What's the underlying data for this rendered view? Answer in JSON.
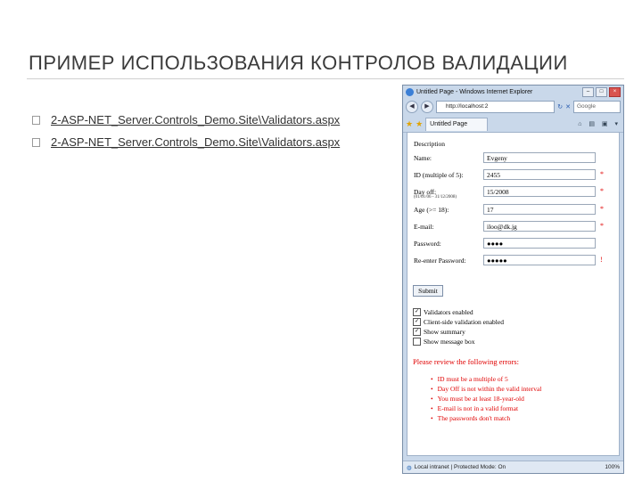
{
  "slide": {
    "title": "ПРИМЕР ИСПОЛЬЗОВАНИЯ КОНТРОЛОВ ВАЛИДАЦИИ",
    "links": [
      "2-ASP-NET_Server.Controls_Demo.Site\\Validators.aspx",
      "2-ASP-NET_Server.Controls_Demo.Site\\Validators.aspx"
    ]
  },
  "browser": {
    "window_title": "Untitled Page - Windows Internet Explorer",
    "address": "http://localhost:2",
    "search_placeholder": "Google",
    "tab_label": "Untitled Page",
    "status_text": "Local intranet | Protected Mode: On",
    "zoom": "100%"
  },
  "form": {
    "heading": "Description",
    "fields": [
      {
        "label": "Name:",
        "note": "",
        "value": "Evgeny",
        "required": ""
      },
      {
        "label": "ID (multiple of 5):",
        "note": "",
        "value": "2455",
        "required": "*"
      },
      {
        "label": "Day off:",
        "note": "(01/01/06 - 31/12/2008)",
        "value": "15/2008",
        "required": "*"
      },
      {
        "label": "Age (>= 18):",
        "note": "",
        "value": "17",
        "required": "*"
      },
      {
        "label": "E-mail:",
        "note": "",
        "value": "iloo@dk.jg",
        "required": "*"
      },
      {
        "label": "Password:",
        "note": "",
        "value": "●●●●",
        "required": ""
      },
      {
        "label": "Re-enter Password:",
        "note": "",
        "value": "●●●●●",
        "required": "!"
      }
    ],
    "submit_label": "Submit",
    "checkboxes": [
      {
        "label": "Validators enabled",
        "checked": "✓"
      },
      {
        "label": "Client-side validation enabled",
        "checked": "✓"
      },
      {
        "label": "Show summary",
        "checked": "✓"
      },
      {
        "label": "Show message box",
        "checked": ""
      }
    ],
    "error_heading": "Please review the following errors:",
    "errors": [
      "ID must be a multiple of 5",
      "Day Off is not within the valid interval",
      "You must be at least 18-year-old",
      "E-mail is not in a valid format",
      "The passwords don't match"
    ]
  }
}
